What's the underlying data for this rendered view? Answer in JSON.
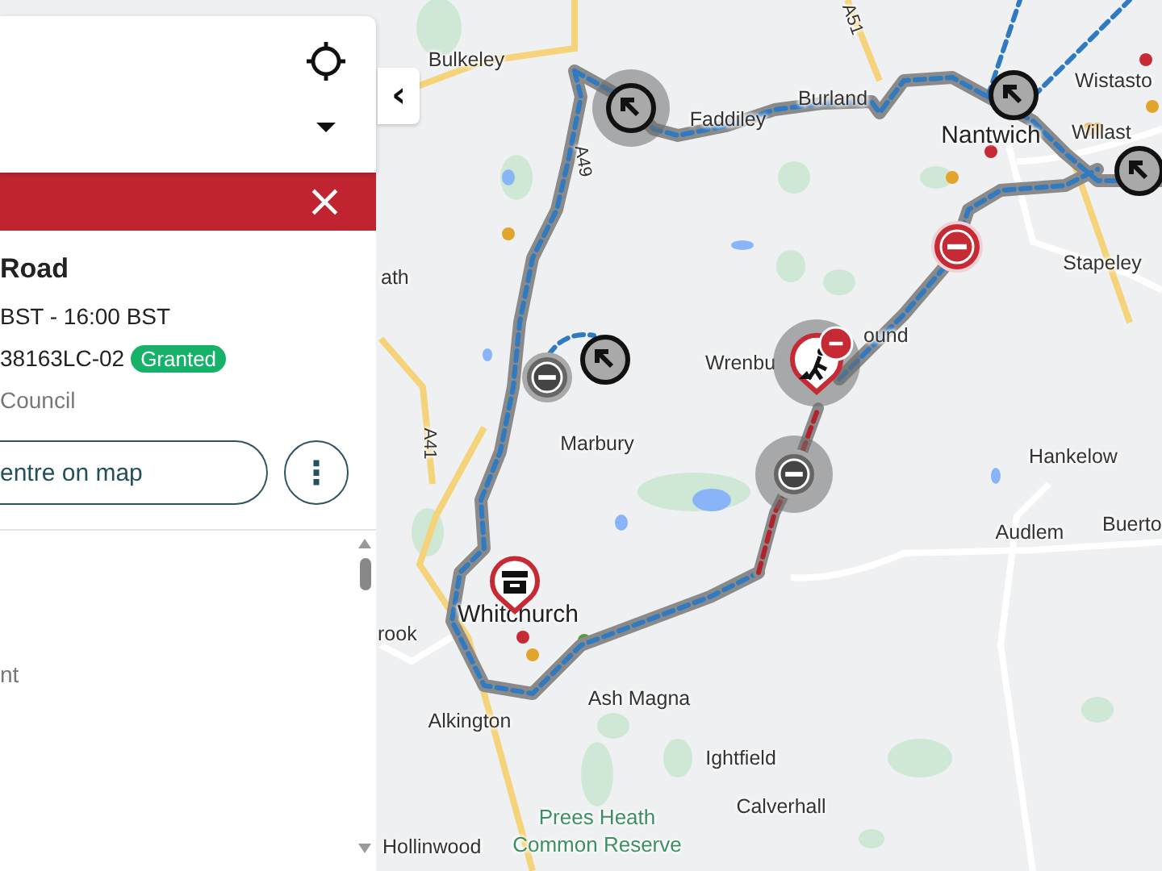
{
  "panel": {
    "header": {
      "locate_button": true,
      "dropdown": true
    },
    "alert_bar": {
      "close": "×"
    },
    "detail": {
      "title": "Road",
      "time": "BST - 16:00 BST",
      "reference": "38163LC-02",
      "status": "Granted",
      "authority": "Council",
      "centre_button": "entre on map",
      "more_button": "⋮"
    },
    "list": {
      "text": "nt"
    },
    "collapse_button": "‹"
  },
  "map": {
    "labels": [
      {
        "text": "Bulkeley",
        "kind": "place"
      },
      {
        "text": "Faddiley",
        "kind": "place"
      },
      {
        "text": "Burland",
        "kind": "place"
      },
      {
        "text": "Nantwich",
        "kind": "town"
      },
      {
        "text": "Wistasto",
        "kind": "place"
      },
      {
        "text": "Willast",
        "kind": "place"
      },
      {
        "text": "Stapeley",
        "kind": "place"
      },
      {
        "text": "ath",
        "kind": "place"
      },
      {
        "text": "Wrenbu",
        "kind": "place"
      },
      {
        "text": "ound",
        "kind": "place"
      },
      {
        "text": "Marbury",
        "kind": "place"
      },
      {
        "text": "Hankelow",
        "kind": "place"
      },
      {
        "text": "Audlem",
        "kind": "place"
      },
      {
        "text": "Buerto",
        "kind": "place"
      },
      {
        "text": "Whitchurch",
        "kind": "town"
      },
      {
        "text": "rook",
        "kind": "place"
      },
      {
        "text": "Ash Magna",
        "kind": "place"
      },
      {
        "text": "Alkington",
        "kind": "place"
      },
      {
        "text": "Ightfield",
        "kind": "place"
      },
      {
        "text": "Calverhall",
        "kind": "place"
      },
      {
        "text": "Hollinwood",
        "kind": "place"
      },
      {
        "text": "Prees Heath Common Reserve",
        "kind": "park"
      },
      {
        "text": "A49",
        "kind": "road"
      },
      {
        "text": "A41",
        "kind": "road"
      },
      {
        "text": "A51",
        "kind": "road"
      }
    ],
    "markers": [
      {
        "kind": "arrow",
        "halo": true
      },
      {
        "kind": "arrow",
        "halo": false
      },
      {
        "kind": "arrow",
        "halo": false
      },
      {
        "kind": "arrow",
        "halo": false
      },
      {
        "kind": "no-entry-grey",
        "halo": false
      },
      {
        "kind": "no-entry-red",
        "halo": false
      },
      {
        "kind": "roadworks-pin",
        "halo": true
      },
      {
        "kind": "no-entry-small",
        "halo": false
      },
      {
        "kind": "no-entry-grey",
        "halo": true
      },
      {
        "kind": "box-pin",
        "halo": false
      }
    ]
  }
}
